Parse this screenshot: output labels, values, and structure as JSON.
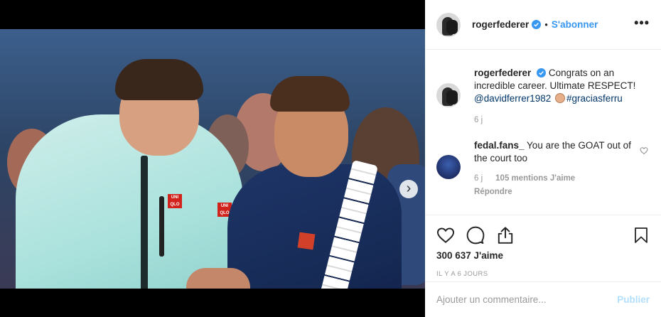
{
  "post": {
    "username": "rogerfederer",
    "follow_label": "S'abonner",
    "bullet": "•",
    "more_label": "•••"
  },
  "caption": {
    "username": "rogerfederer",
    "text_part1": "Congrats on an incredible career. Ultimate RESPECT!",
    "mention": "@davidferrer1982",
    "hashtag": "#graciasferru",
    "time": "6 j"
  },
  "comment": {
    "username": "fedal.fans_",
    "text": "You are the GOAT out of the court too",
    "time": "6 j",
    "likes": "105 mentions J'aime",
    "reply_label": "Répondre"
  },
  "photo": {
    "logo_text": "UNI QLO",
    "carousel_next": "›"
  },
  "actions": {
    "likes_count": "300 637 J'aime",
    "date": "IL Y A 6 JOURS"
  },
  "add_comment": {
    "placeholder": "Ajouter un commentaire...",
    "publish_label": "Publier"
  },
  "colors": {
    "accent": "#3897f0",
    "link": "#003569",
    "muted": "#999999",
    "publish_disabled": "#b2dffc"
  }
}
